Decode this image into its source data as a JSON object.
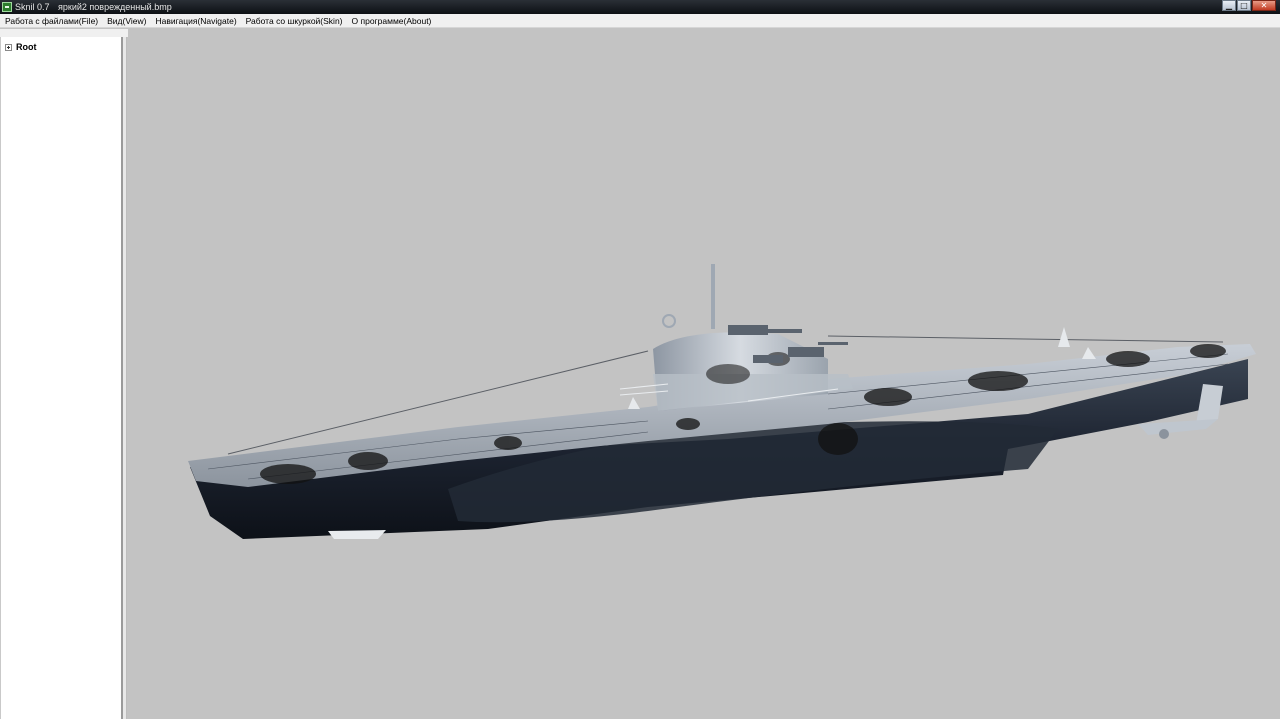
{
  "window": {
    "app_name": "Sknil 0.7",
    "file_name": "яркий2 поврежденный.bmp",
    "buttons": {
      "minimize": "▁",
      "maximize": "□",
      "close": "✕"
    }
  },
  "menu": {
    "items": [
      {
        "label": "Работа с файлами(File)"
      },
      {
        "label": "Вид(View)"
      },
      {
        "label": "Навигация(Navigate)"
      },
      {
        "label": "Работа со шкуркой(Skin)"
      },
      {
        "label": "О программе(About)"
      }
    ]
  },
  "tree": {
    "root_label": "Root"
  },
  "viewport": {
    "background": "#c3c3c3",
    "model_icon": "submarine-model"
  }
}
